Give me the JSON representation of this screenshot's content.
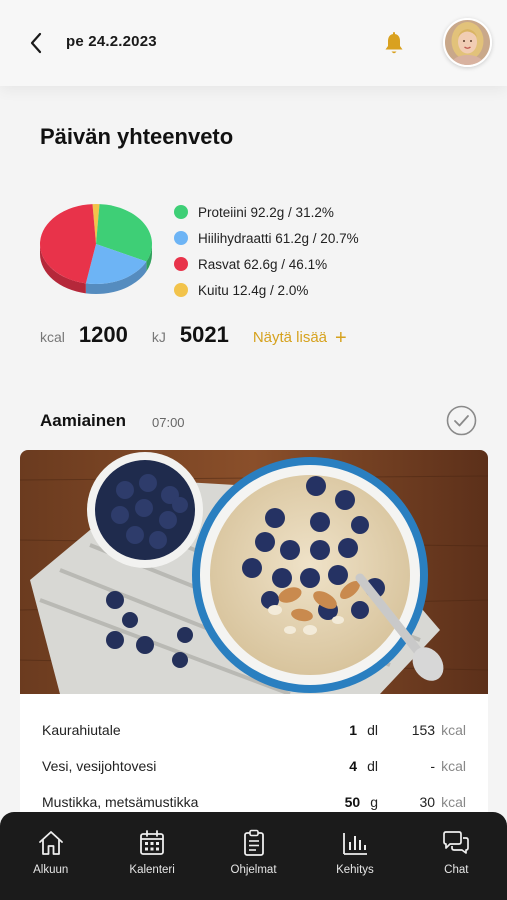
{
  "header": {
    "date": "pe 24.2.2023",
    "icons": {
      "back": "chevron-left-icon",
      "notification": "bell-icon",
      "avatar": "avatar"
    },
    "accent_color": "#D9A11F"
  },
  "summary": {
    "title": "Päivän yhteenveto",
    "legend": [
      {
        "label": "Proteiini 92.2g / 31.2%",
        "color": "#3ECF76"
      },
      {
        "label": "Hiilihydraatti 61.2g / 20.7%",
        "color": "#6DB4F5"
      },
      {
        "label": "Rasvat 62.6g / 46.1%",
        "color": "#E8334A"
      },
      {
        "label": "Kuitu 12.4g / 2.0%",
        "color": "#F2C34B"
      }
    ],
    "energy": {
      "kcal_unit": "kcal",
      "kcal_value": "1200",
      "kj_unit": "kJ",
      "kj_value": "5021",
      "more_label": "Näytä lisää",
      "more_icon": "plus-icon"
    }
  },
  "chart_data": {
    "type": "pie",
    "slices": [
      {
        "label": "Proteiini",
        "value": 31.2,
        "color": "#3ECF76"
      },
      {
        "label": "Hiilihydraatti",
        "value": 20.7,
        "color": "#6DB4F5"
      },
      {
        "label": "Rasvat",
        "value": 46.1,
        "color": "#E8334A"
      },
      {
        "label": "Kuitu",
        "value": 2.0,
        "color": "#F2C34B"
      }
    ]
  },
  "meal": {
    "title": "Aamiainen",
    "time": "07:00",
    "check_icon": "check-circle-icon",
    "items": [
      {
        "name": "Kaurahiutale",
        "amount": "1",
        "unit": "dl",
        "kcal": "153",
        "kcal_unit": "kcal"
      },
      {
        "name": "Vesi, vesijohtovesi",
        "amount": "4",
        "unit": "dl",
        "kcal": "-",
        "kcal_unit": "kcal"
      },
      {
        "name": "Mustikka, metsämustikka",
        "amount": "50",
        "unit": "g",
        "kcal": "30",
        "kcal_unit": "kcal"
      }
    ]
  },
  "nav": [
    {
      "label": "Alkuun",
      "icon": "home-icon"
    },
    {
      "label": "Kalenteri",
      "icon": "calendar-icon"
    },
    {
      "label": "Ohjelmat",
      "icon": "clipboard-icon"
    },
    {
      "label": "Kehitys",
      "icon": "bar-chart-icon"
    },
    {
      "label": "Chat",
      "icon": "chat-bubbles-icon"
    }
  ]
}
